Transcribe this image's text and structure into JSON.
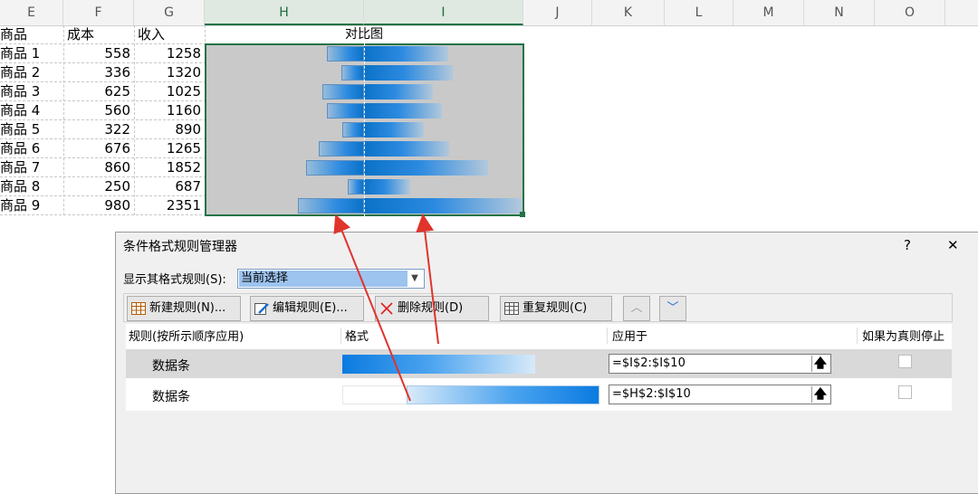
{
  "columns": [
    "E",
    "F",
    "G",
    "H",
    "I",
    "J",
    "K",
    "L",
    "M",
    "N",
    "O"
  ],
  "sheet": {
    "headers": {
      "name": "商品",
      "cost": "成本",
      "revenue": "收入",
      "chart": "对比图"
    },
    "rows": [
      {
        "name": "商品 1",
        "cost": 558,
        "revenue": 1258
      },
      {
        "name": "商品 2",
        "cost": 336,
        "revenue": 1320
      },
      {
        "name": "商品 3",
        "cost": 625,
        "revenue": 1025
      },
      {
        "name": "商品 4",
        "cost": 560,
        "revenue": 1160
      },
      {
        "name": "商品 5",
        "cost": 322,
        "revenue": 890
      },
      {
        "name": "商品 6",
        "cost": 676,
        "revenue": 1265
      },
      {
        "name": "商品 7",
        "cost": 860,
        "revenue": 1852
      },
      {
        "name": "商品 8",
        "cost": 250,
        "revenue": 687
      },
      {
        "name": "商品 9",
        "cost": 980,
        "revenue": 2351
      }
    ],
    "colors": {
      "bar": "#0a72c8",
      "gray_fill": "#c9c9c9",
      "selection": "#217346"
    }
  },
  "dialog": {
    "title": "条件格式规则管理器",
    "help": "?",
    "close": "✕",
    "show_label": "显示其格式规则(S):",
    "show_value": "当前选择",
    "buttons": {
      "new": "新建规则(N)...",
      "edit": "编辑规则(E)...",
      "delete": "删除规则(D)",
      "duplicate": "重复规则(C)"
    },
    "table_headers": {
      "rule": "规则(按所示顺序应用)",
      "format": "格式",
      "applies": "应用于",
      "stop": "如果为真则停止"
    },
    "rules": [
      {
        "name": "数据条",
        "applies": "=$I$2:$I$10",
        "selected": true
      },
      {
        "name": "数据条",
        "applies": "=$H$2:$I$10",
        "selected": false
      }
    ]
  }
}
